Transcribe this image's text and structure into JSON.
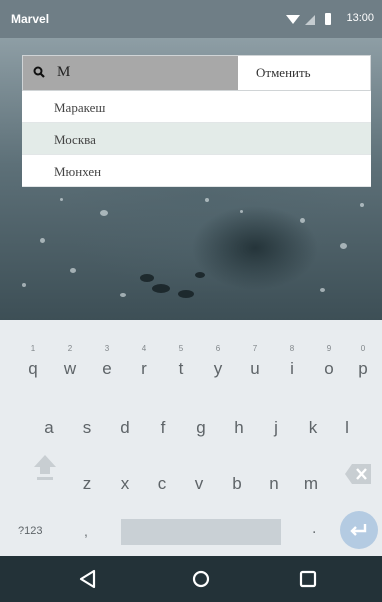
{
  "status_bar": {
    "app_name": "Marvel",
    "time": "13:00",
    "icons": [
      "wifi-icon",
      "signal-icon",
      "battery-icon"
    ]
  },
  "search": {
    "query": "M",
    "cancel_label": "Отменить",
    "icon": "search-icon"
  },
  "suggestions": [
    {
      "label": "Маракеш",
      "selected": false
    },
    {
      "label": "Москва",
      "selected": true
    },
    {
      "label": "Мюнхен",
      "selected": false
    }
  ],
  "keyboard": {
    "row1": [
      {
        "hint": "1",
        "key": "q"
      },
      {
        "hint": "2",
        "key": "w"
      },
      {
        "hint": "3",
        "key": "e"
      },
      {
        "hint": "4",
        "key": "r"
      },
      {
        "hint": "5",
        "key": "t"
      },
      {
        "hint": "6",
        "key": "y"
      },
      {
        "hint": "7",
        "key": "u"
      },
      {
        "hint": "8",
        "key": "i"
      },
      {
        "hint": "9",
        "key": "o"
      },
      {
        "hint": "0",
        "key": "p"
      }
    ],
    "row2": [
      "a",
      "s",
      "d",
      "f",
      "g",
      "h",
      "j",
      "k",
      "l"
    ],
    "row3": [
      "z",
      "x",
      "c",
      "v",
      "b",
      "n",
      "m"
    ],
    "symbols_label": "?123",
    "comma_label": ",",
    "period_label": ".",
    "icons": [
      "shift-icon",
      "backspace-icon",
      "enter-icon"
    ]
  },
  "nav_bar": {
    "icons": [
      "back-icon",
      "home-icon",
      "recents-icon"
    ]
  },
  "colors": {
    "status_bar": "#6f7e86",
    "keyboard_bg": "#e8ecef",
    "enter_key": "#b4cbe2",
    "nav_bar": "#233238",
    "selected_suggestion": "#e3ebe8"
  }
}
